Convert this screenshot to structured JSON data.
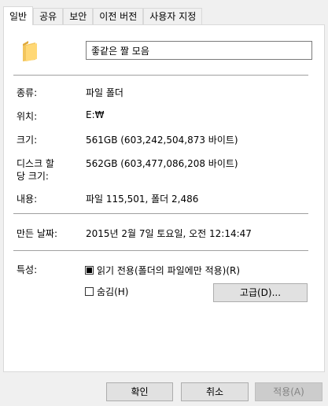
{
  "tabs": [
    "일반",
    "공유",
    "보안",
    "이전 버전",
    "사용자 지정"
  ],
  "folder_name": "좋같은 짤 모음",
  "general": {
    "type": {
      "label": "종류:",
      "value": "파일 폴더"
    },
    "location": {
      "label": "위치:",
      "value": "E:₩"
    },
    "size": {
      "label": "크기:",
      "value": "561GB (603,242,504,873 바이트)"
    },
    "size_on_disk": {
      "label_line1": "디스크 할",
      "label_line2": "당 크기:",
      "value": "562GB (603,477,086,208 바이트)"
    },
    "contains": {
      "label": "내용:",
      "value": "파일 115,501, 폴더 2,486"
    },
    "created": {
      "label": "만든 날짜:",
      "value": "2015년 2월 7일 토요일, 오전 12:14:47"
    },
    "attributes": {
      "label": "특성:",
      "readonly_label": "읽기 전용(폴더의 파일에만 적용)(R)",
      "hidden_label": "숨김(H)",
      "advanced_button": "고급(D)..."
    }
  },
  "buttons": {
    "ok": "확인",
    "cancel": "취소",
    "apply": "적용(A)"
  }
}
